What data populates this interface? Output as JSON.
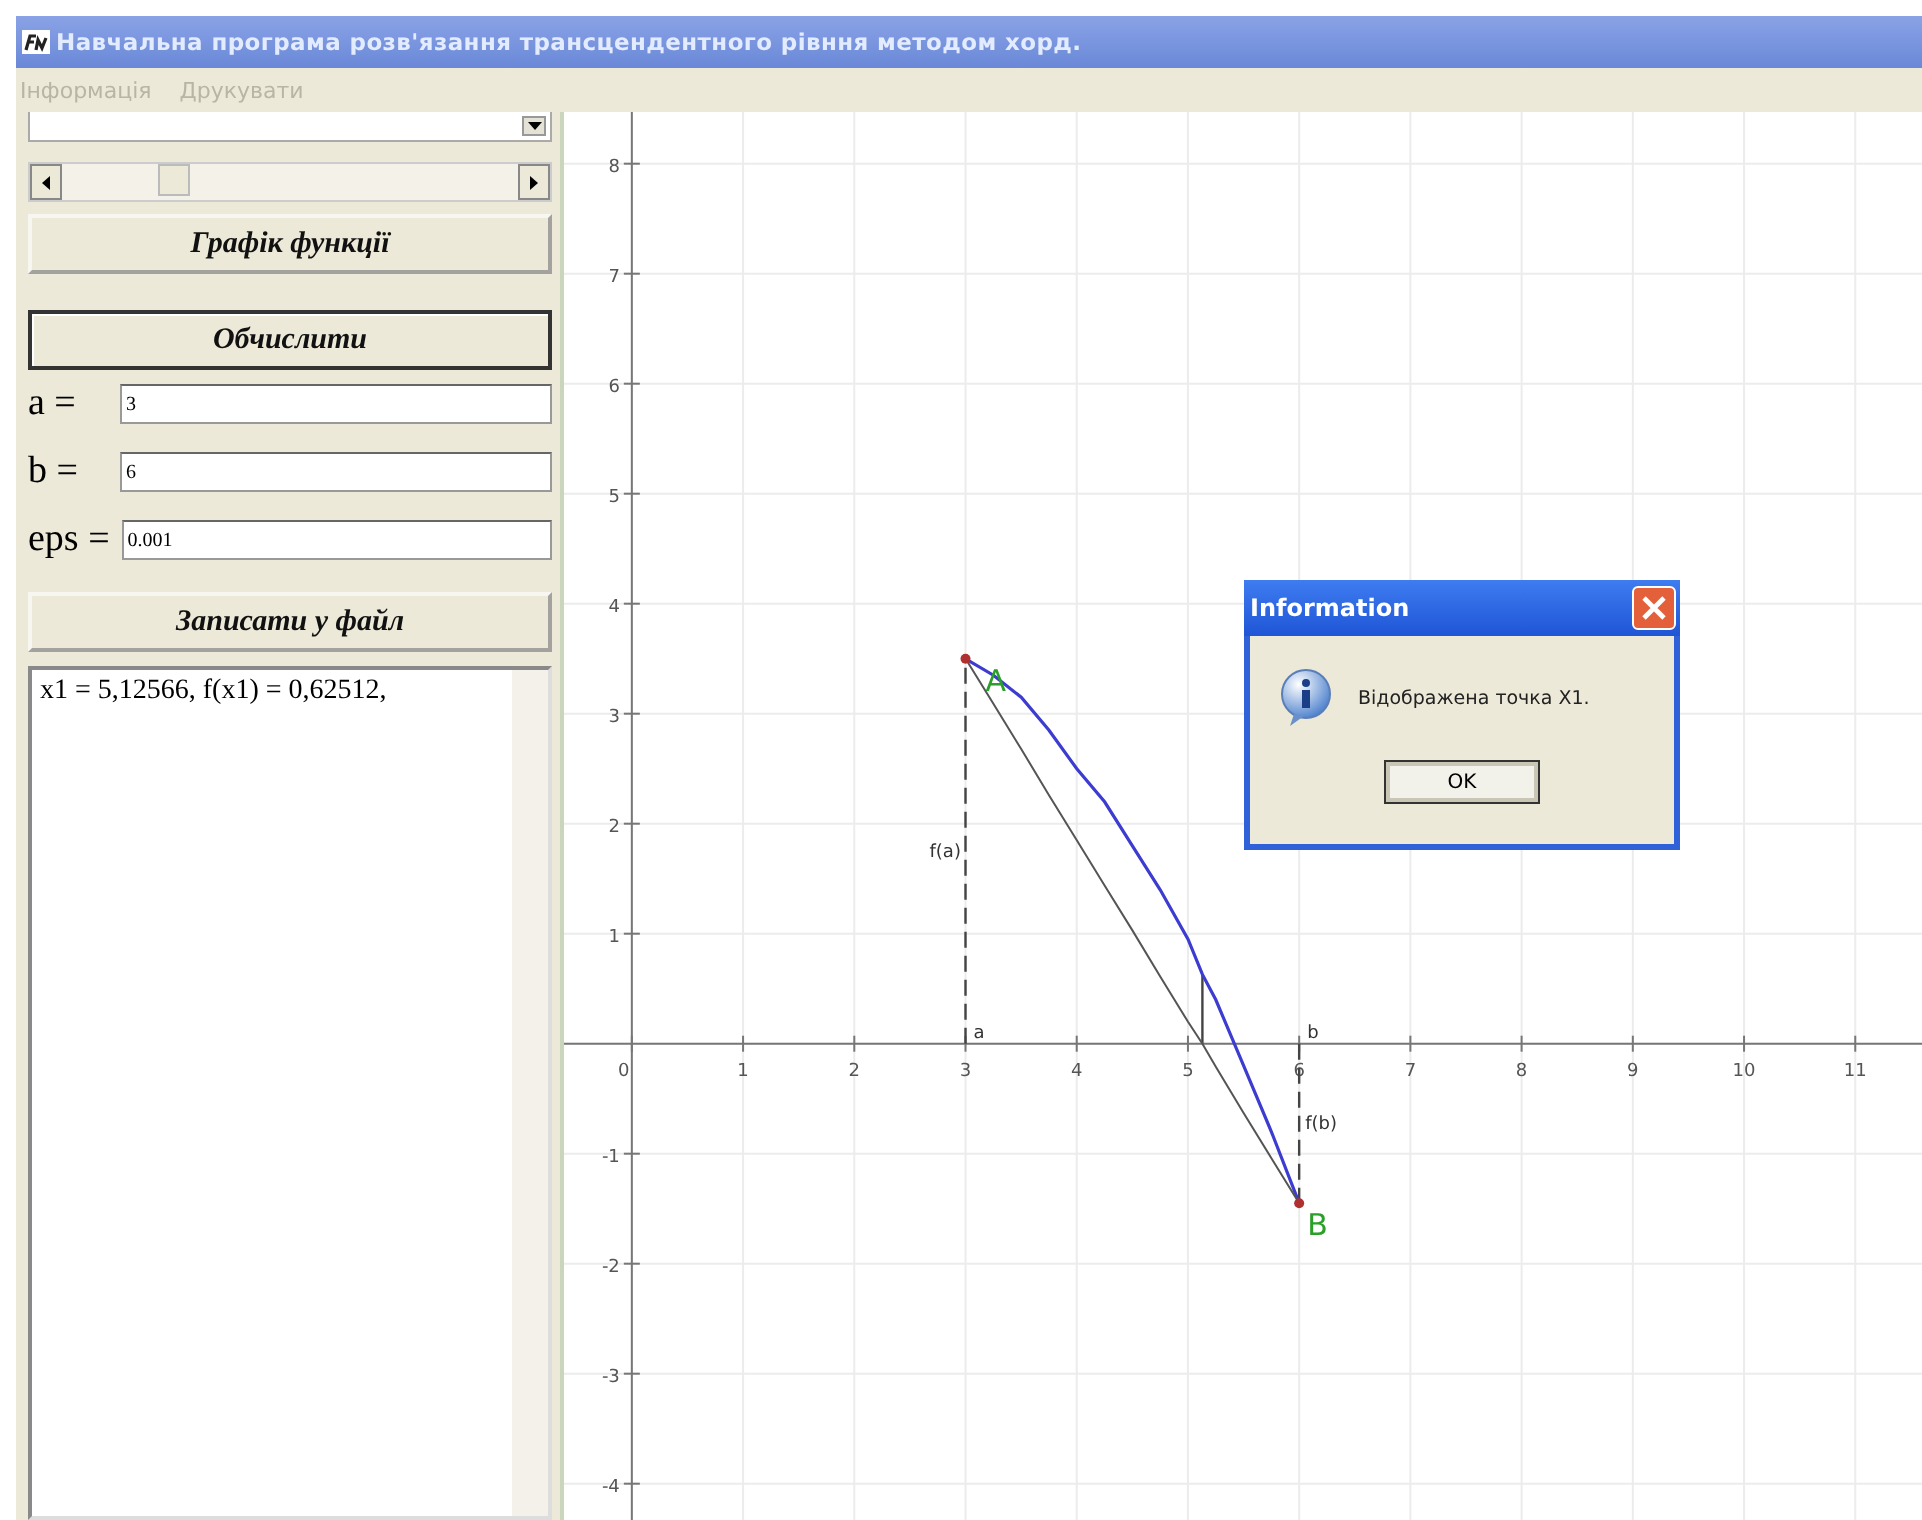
{
  "window": {
    "title": "Навчальна програма розв'язання трансцендентного рівння методом хорд."
  },
  "menu": [
    {
      "label": "Інформація",
      "disabled": true
    },
    {
      "label": "Друкувати",
      "disabled": true
    }
  ],
  "controls": [
    {
      "kind": "combobox"
    },
    {
      "kind": "scrollbar"
    },
    {
      "kind": "button",
      "label": "Графік функції",
      "default": false
    },
    {
      "kind": "button",
      "label": "Обчислити",
      "default": true
    },
    {
      "kind": "field",
      "label": "a =",
      "value": "3"
    },
    {
      "kind": "field",
      "label": "b =",
      "value": "6"
    },
    {
      "kind": "field",
      "label": "eps =",
      "value": "0.001"
    },
    {
      "kind": "button",
      "label": "Записати у файл",
      "default": false
    },
    {
      "kind": "memo",
      "text": "x1 = 5,12566, f(x1) = 0,62512,"
    }
  ],
  "graph": {
    "chart_data": {
      "type": "line",
      "x": [
        3,
        3.25,
        3.5,
        3.75,
        4,
        4.25,
        4.5,
        4.75,
        5,
        5.13,
        5.25,
        5.5,
        5.75,
        6
      ],
      "series": [
        {
          "color": "#3c3cd0",
          "values": [
            3.5,
            3.35,
            3.15,
            2.85,
            2.5,
            2.2,
            1.8,
            1.4,
            0.95,
            0.63,
            0.4,
            -0.2,
            -0.8,
            -1.45
          ]
        },
        {
          "color": "#555555",
          "values": [
            3.5,
            3.09,
            2.68,
            2.26,
            1.85,
            1.44,
            1.03,
            0.61,
            0.2,
            0,
            -0.21,
            -0.63,
            -1.04,
            -1.45
          ]
        }
      ],
      "xlim": [
        -0.61,
        11.6
      ],
      "ylim": [
        -4.33,
        8.47
      ],
      "xticks": [
        0,
        1,
        2,
        3,
        4,
        5,
        6,
        7,
        8,
        9,
        10,
        11
      ],
      "yticks": [
        -4,
        -3,
        -2,
        -1,
        1,
        2,
        3,
        4,
        5,
        6,
        7,
        8
      ],
      "grid": true,
      "annotations": [
        "A",
        "B",
        "a",
        "b",
        "f(a)",
        "f(b)"
      ]
    }
  },
  "dialog": {
    "title": "Information",
    "message": "Відображена точка X1.",
    "button": "OK"
  }
}
